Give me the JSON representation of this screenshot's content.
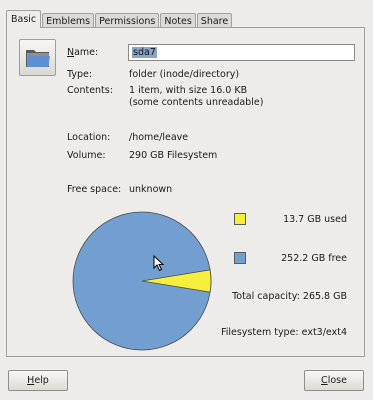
{
  "tabs": [
    "Basic",
    "Emblems",
    "Permissions",
    "Notes",
    "Share"
  ],
  "basic": {
    "name_label": "Name:",
    "name_value": "sda7",
    "type_label": "Type:",
    "type_value": "folder (inode/directory)",
    "contents_label": "Contents:",
    "contents_value_line1": "1 item, with size 16.0 KB",
    "contents_value_line2": "(some contents unreadable)",
    "location_label": "Location:",
    "location_value": "/home/leave",
    "volume_label": "Volume:",
    "volume_value": "290 GB Filesystem",
    "free_space_label": "Free space:",
    "free_space_value": "unknown"
  },
  "usage": {
    "used_label": "13.7 GB used",
    "free_label": "252.2 GB free",
    "total_capacity": "Total capacity: 265.8 GB",
    "filesystem_type": "Filesystem type: ext3/ext4",
    "used_fraction": 0.0515,
    "used_color": "#f5ee3c",
    "free_color": "#729fcf"
  },
  "buttons": {
    "help": "Help",
    "close": "Close"
  }
}
